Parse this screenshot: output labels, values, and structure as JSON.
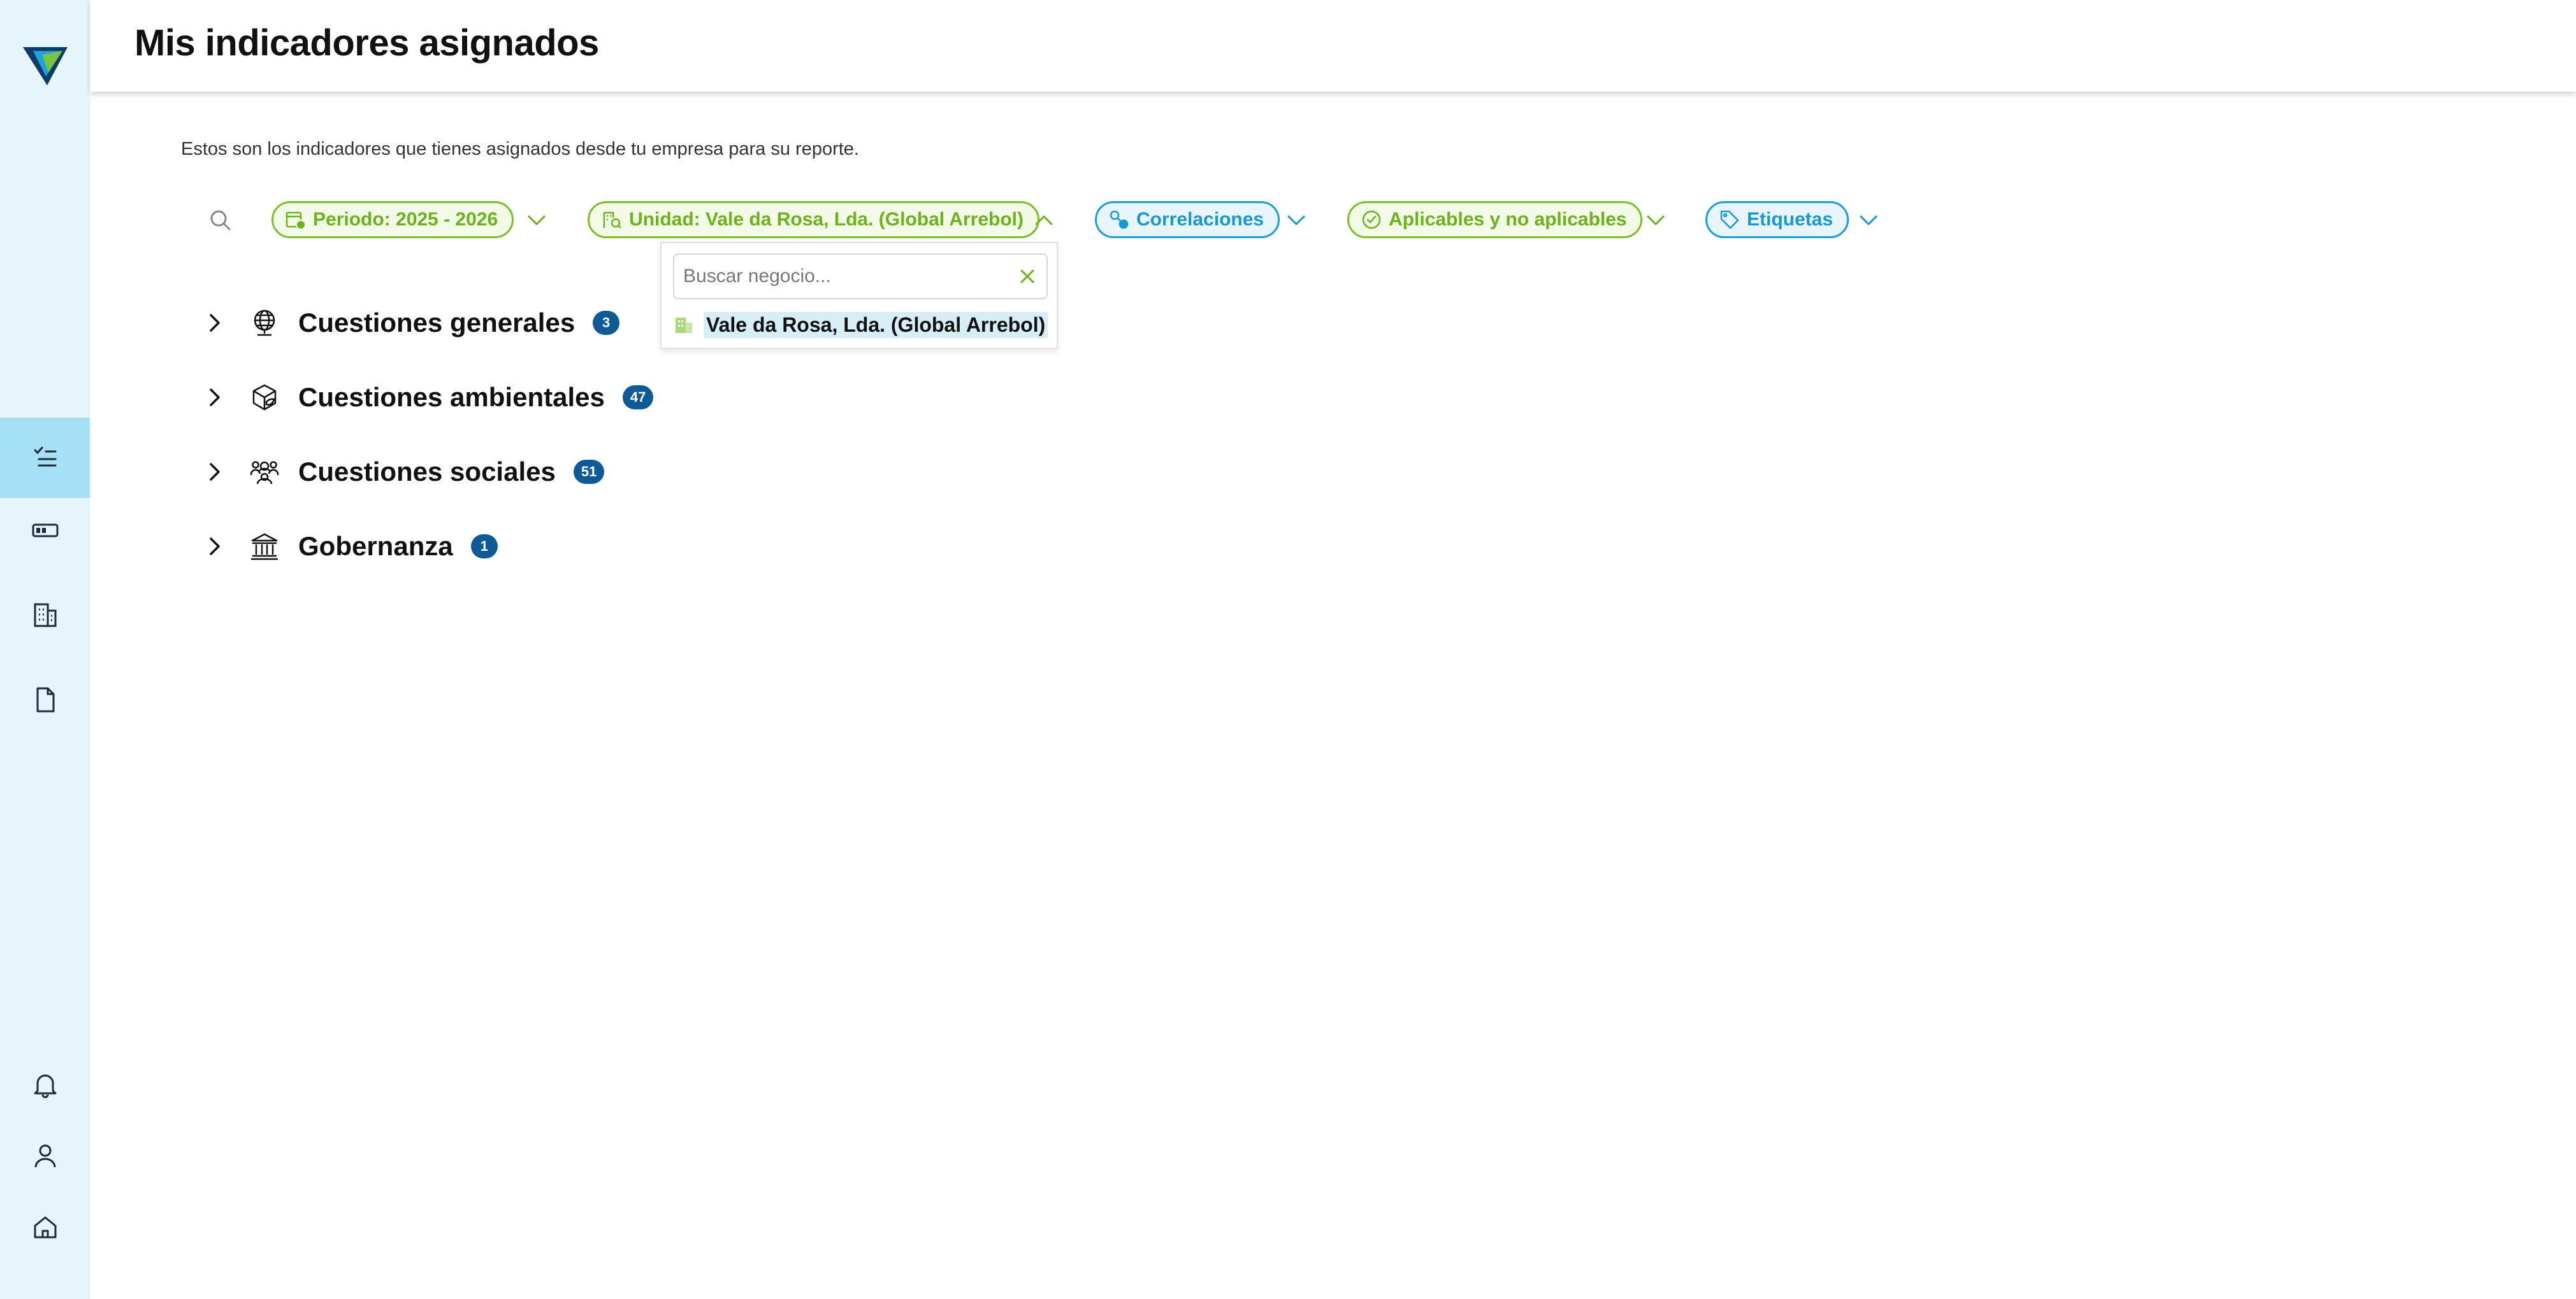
{
  "header": {
    "title": "Mis indicadores asignados"
  },
  "intro": "Estos son los indicadores que tienes asignados desde tu empresa para su reporte.",
  "filters": {
    "period": "Periodo: 2025 - 2026",
    "unit": "Unidad: Vale da Rosa, Lda. (Global Arrebol)",
    "correlations": "Correlaciones",
    "applicability": "Aplicables y no aplicables",
    "tags": "Etiquetas"
  },
  "unit_dropdown": {
    "placeholder": "Buscar negocio...",
    "options": [
      "Vale da Rosa, Lda. (Global Arrebol)"
    ]
  },
  "categories": [
    {
      "label": "Cuestiones generales",
      "count": "3",
      "icon": "globe-icon"
    },
    {
      "label": "Cuestiones ambientales",
      "count": "47",
      "icon": "leaf-cube-icon"
    },
    {
      "label": "Cuestiones sociales",
      "count": "51",
      "icon": "people-group-icon"
    },
    {
      "label": "Gobernanza",
      "count": "1",
      "icon": "bank-building-icon"
    }
  ],
  "sidebar": {
    "items": [
      "checklist-icon",
      "battery-icon",
      "building-icon",
      "document-icon",
      "bell-icon",
      "user-icon",
      "home-icon"
    ]
  },
  "colors": {
    "green": "#6cb31b",
    "blue": "#1698d0",
    "badge": "#0d5a96",
    "sidebar": "#e6f5fc",
    "sidebar_active": "#a6e0f6"
  }
}
